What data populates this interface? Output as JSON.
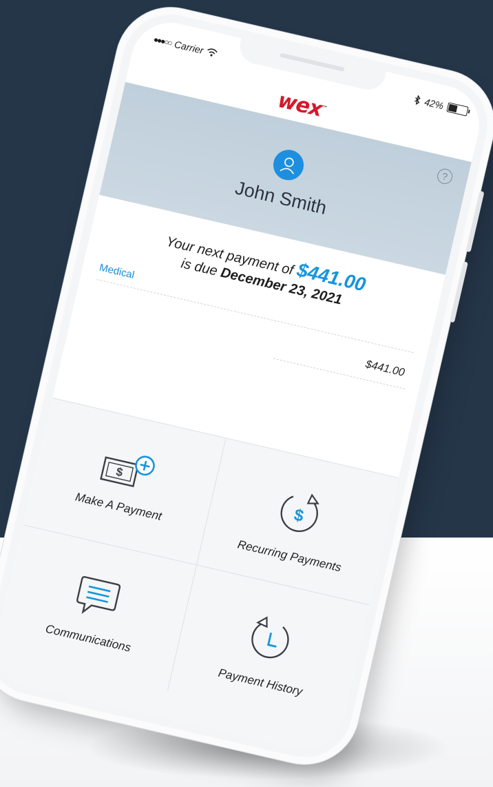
{
  "status_bar": {
    "signal": "●●●○○",
    "carrier": "Carrier",
    "battery": "42%"
  },
  "brand": {
    "logo_text": "wex",
    "logo_mark": "™"
  },
  "hero": {
    "user_name": "John Smith",
    "help_icon": "?"
  },
  "payment": {
    "line1_prefix": "Your next payment of ",
    "amount": "$441.00",
    "line2_prefix": "is due ",
    "due_date": "December 23, 2021",
    "account_label": "Medical",
    "line_amount": "$441.00"
  },
  "actions": [
    {
      "label": "Make A Payment",
      "icon": "make-payment-icon"
    },
    {
      "label": "Recurring Payments",
      "icon": "recurring-payments-icon"
    },
    {
      "label": "Communications",
      "icon": "communications-icon"
    },
    {
      "label": "Payment History",
      "icon": "payment-history-icon"
    }
  ],
  "colors": {
    "background": "#253649",
    "accent": "#1595dc",
    "brand": "#d5192b"
  }
}
